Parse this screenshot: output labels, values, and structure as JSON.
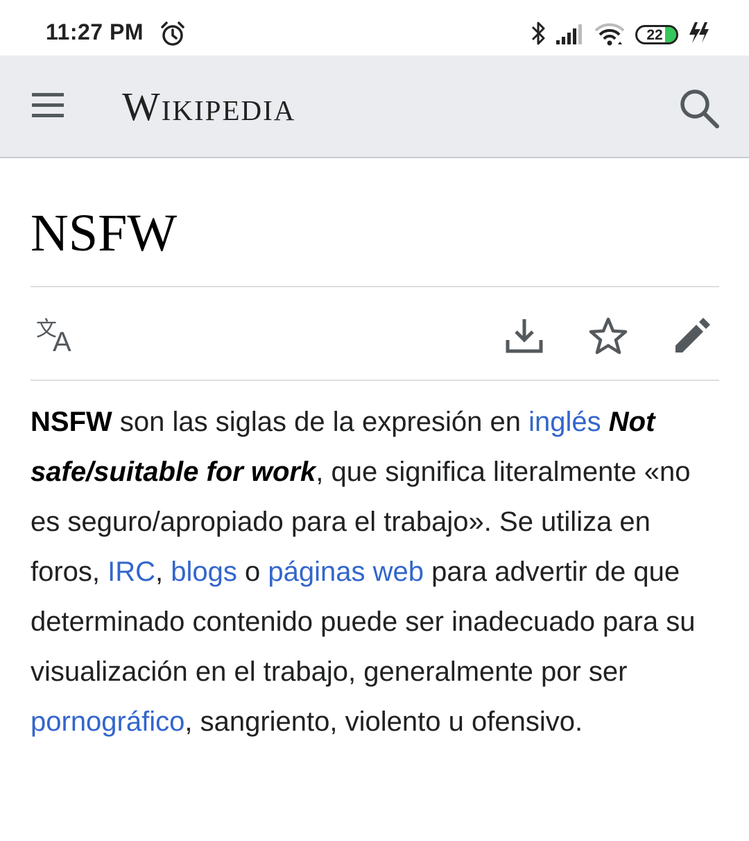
{
  "status_bar": {
    "time": "11:27 PM",
    "battery_level": "22",
    "icons": [
      "alarm-icon",
      "bluetooth-icon",
      "signal-icon",
      "wifi-icon",
      "battery-icon",
      "charging-icon"
    ],
    "battery_color": "#34c759"
  },
  "header": {
    "logo_text": "Wikipedia",
    "menu_icon": "hamburger-menu-icon",
    "search_icon": "search-icon",
    "background": "#eaecf0"
  },
  "article": {
    "title": "NSFW",
    "toolbar": {
      "language_icon": "language-translate-icon",
      "download_icon": "download-icon",
      "watch_icon": "star-icon",
      "edit_icon": "edit-pencil-icon"
    },
    "paragraph": {
      "bold_term": "NSFW",
      "t1": " son las siglas de la expresión en ",
      "link_ingles": "inglés",
      "t2": " ",
      "italic_bold": "Not safe/suitable for work",
      "t3": ", que significa literalmente «no es seguro/apropiado para el trabajo». Se utiliza en foros, ",
      "link_irc": "IRC",
      "t4": ", ",
      "link_blogs": "blogs",
      "t5": " o ",
      "link_paginas_web": "páginas web",
      "t6": " para advertir de que determinado contenido puede ser inadecuado para su visualización en el trabajo, generalmente por ser ",
      "link_pornografico": "pornográfico",
      "t7": ", sangriento, violento u ofensivo."
    },
    "link_color": "#3366cc"
  }
}
